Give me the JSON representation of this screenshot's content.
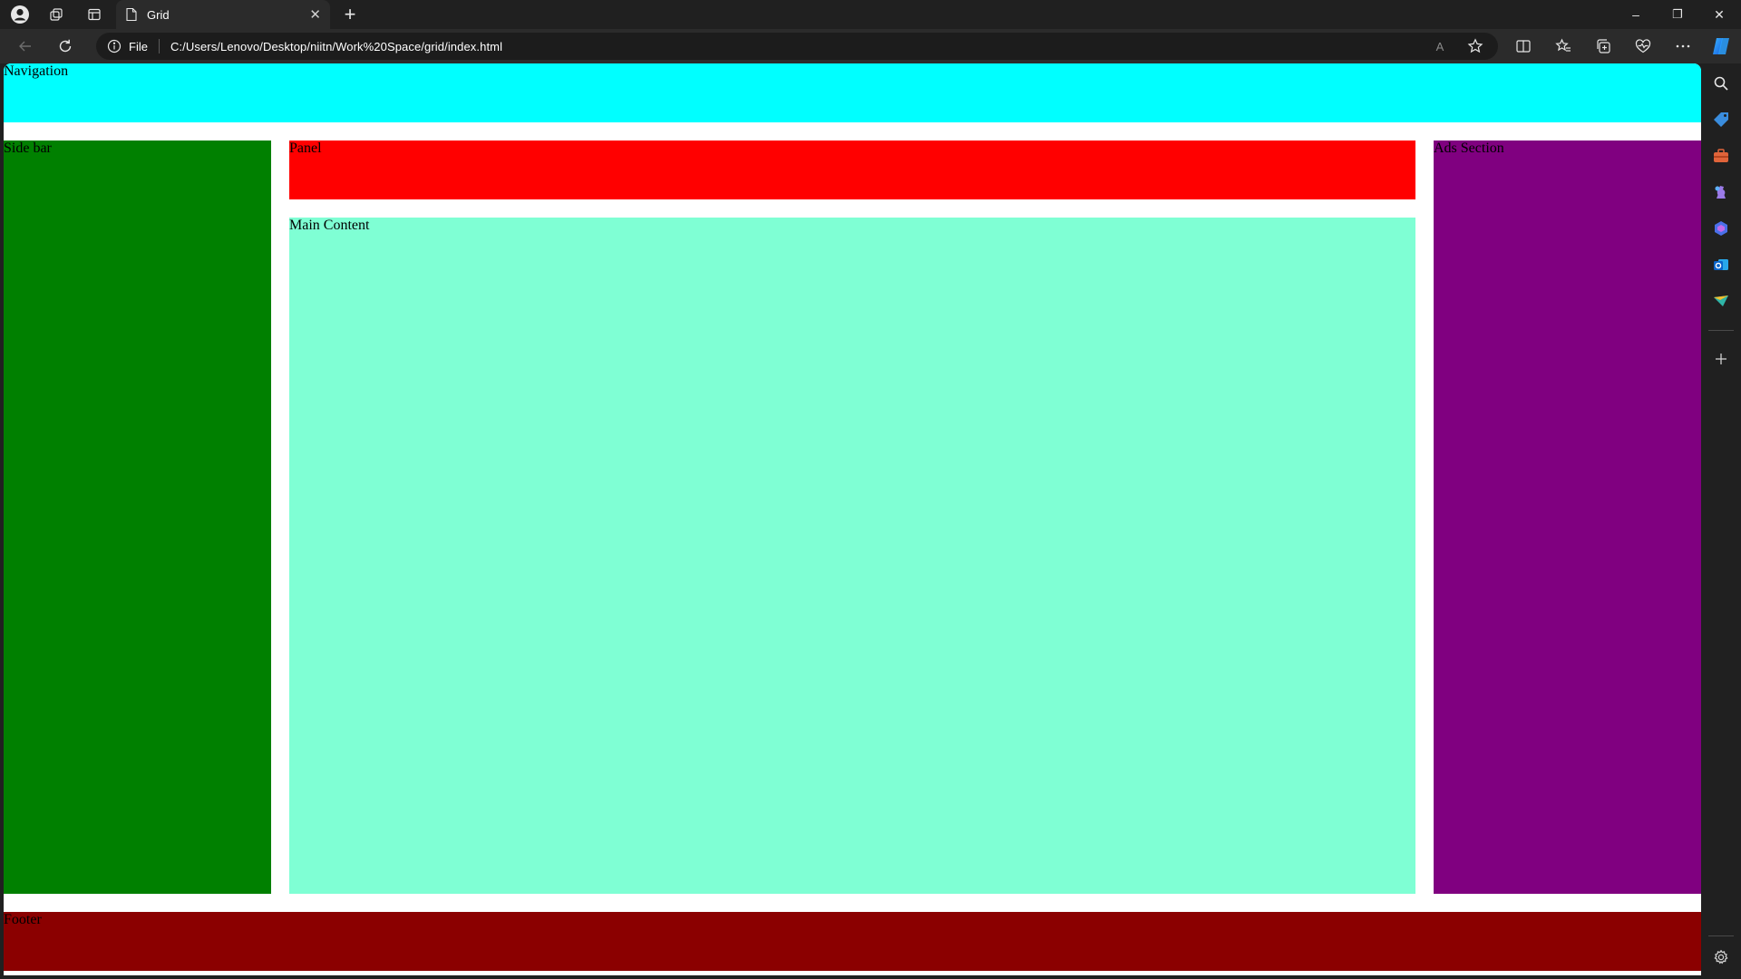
{
  "browser": {
    "tab": {
      "title": "Grid",
      "close_glyph": "✕",
      "new_tab_glyph": "+"
    },
    "address": {
      "security_label": "File",
      "url": "C:/Users/Lenovo/Desktop/niitn/Work%20Space/grid/index.html"
    },
    "window_controls": {
      "minimize": "–",
      "restore": "❐",
      "close": "✕"
    },
    "read_aloud_glyph": "A",
    "colors": {
      "chrome_bg": "#202020",
      "toolbar_bg": "#2b2b2b",
      "omnibox_bg": "#1c1c1c"
    }
  },
  "page": {
    "navigation": {
      "label": "Navigation",
      "color": "#00ffff"
    },
    "sidebar": {
      "label": "Side bar",
      "color": "#008000"
    },
    "panel": {
      "label": "Panel",
      "color": "#ff0000"
    },
    "main_content": {
      "label": "Main Content",
      "color": "#7fffd4"
    },
    "ads": {
      "label": "Ads Section",
      "color": "#800080"
    },
    "footer": {
      "label": "Footer",
      "color": "#8b0000"
    }
  },
  "edge_sidebar": {
    "icons": [
      "search-icon",
      "tag-icon",
      "toolbox-icon",
      "chess-icon",
      "copilot-app-icon",
      "outlook-icon",
      "send-icon",
      "add-icon",
      "settings-icon"
    ]
  }
}
